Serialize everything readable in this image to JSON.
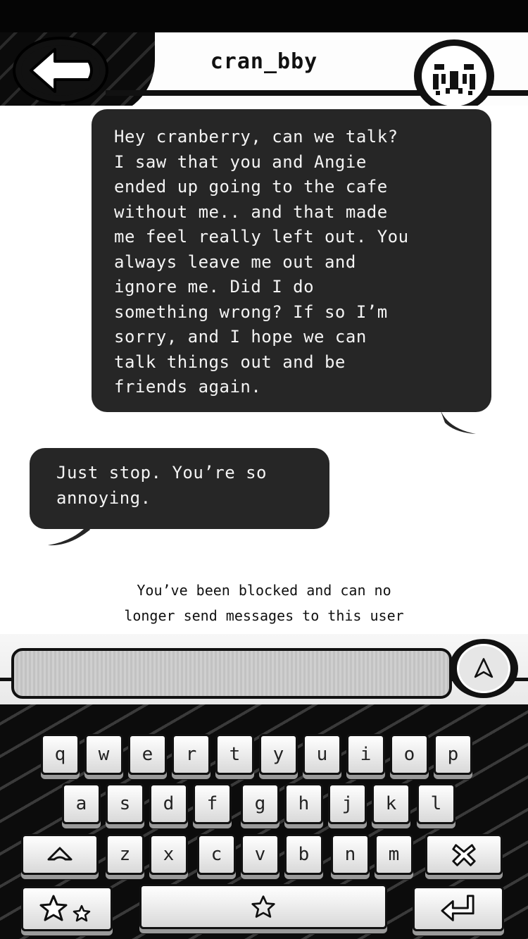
{
  "header": {
    "title": "cran_bby",
    "back_icon": "back-arrow-icon",
    "avatar_icon": "glitch-face-avatar"
  },
  "messages": [
    {
      "direction": "outgoing",
      "text": "Hey cranberry, can we talk?\nI saw that you and Angie\nended up going to the cafe\nwithout me.. and that made\nme feel really left out. You\nalways leave me out and\nignore me. Did I do\nsomething wrong? If so I’m\nsorry, and I hope we can\ntalk things out and be\nfriends again."
    },
    {
      "direction": "incoming",
      "text": "Just stop. You’re so\nannoying."
    }
  ],
  "notice": "You’ve been blocked and can no\nlonger send messages to this user",
  "composer": {
    "placeholder": "",
    "send_icon": "send-arrow-icon"
  },
  "keyboard": {
    "row1": [
      "q",
      "w",
      "e",
      "r",
      "t",
      "y",
      "u",
      "i",
      "o",
      "p"
    ],
    "row2": [
      "a",
      "s",
      "d",
      "f",
      "g",
      "h",
      "j",
      "k",
      "l"
    ],
    "row3": [
      "z",
      "x",
      "c",
      "v",
      "b",
      "n",
      "m"
    ],
    "shift_icon": "shift-arrow-icon",
    "delete_icon": "delete-x-icon",
    "emoji_icon": "stars-icon",
    "space_icon": "star-icon",
    "enter_icon": "return-arrow-icon"
  },
  "colors": {
    "bubble": "#262626",
    "bubble_text": "#f4f4f4",
    "ink": "#111111",
    "background": "#ffffff"
  }
}
